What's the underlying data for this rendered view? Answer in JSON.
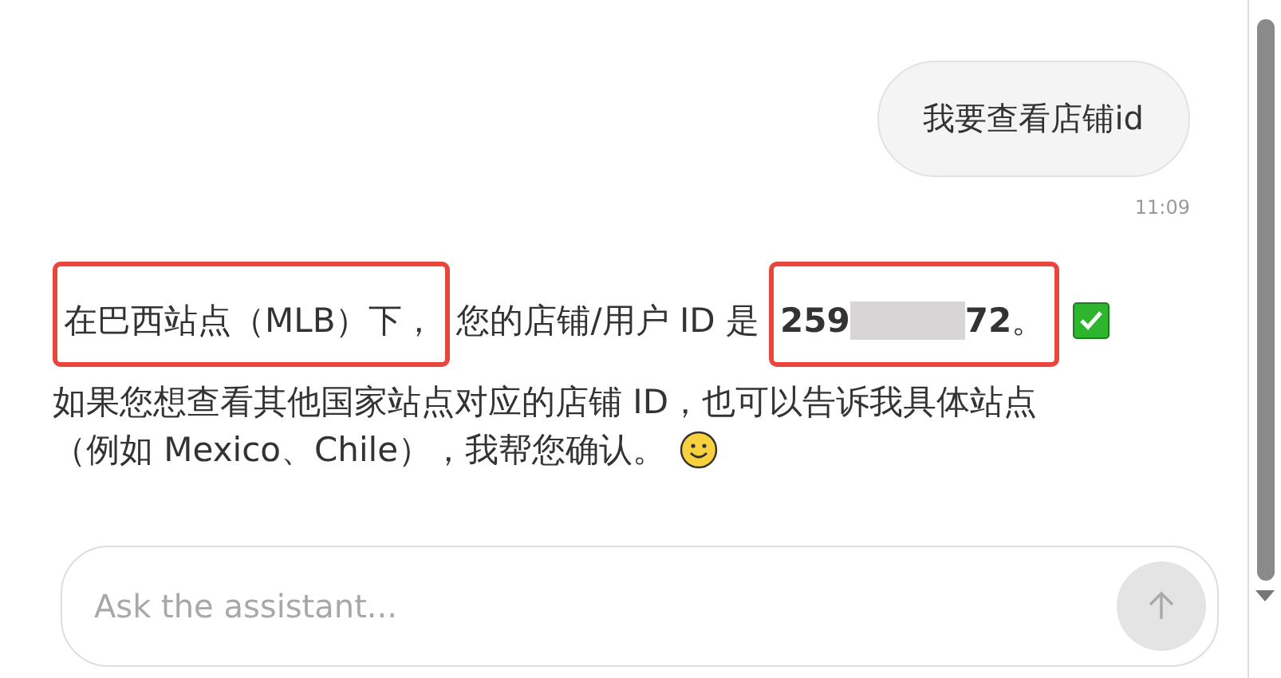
{
  "user_message": {
    "text": "我要查看店铺id",
    "time": "11:09"
  },
  "assistant_message": {
    "place": "在巴西站点（MLB）下，",
    "label": "您的店铺/用户 ID 是",
    "id_start": "259",
    "id_end": "72",
    "end_mark": "。",
    "paragraph_lines": [
      "如果您想查看其他国家站点对应的店铺 ID，也可以告诉我具体站点",
      "（例如 Mexico、Chile），我帮您确认。"
    ]
  },
  "composer": {
    "placeholder": "Ask the assistant..."
  }
}
